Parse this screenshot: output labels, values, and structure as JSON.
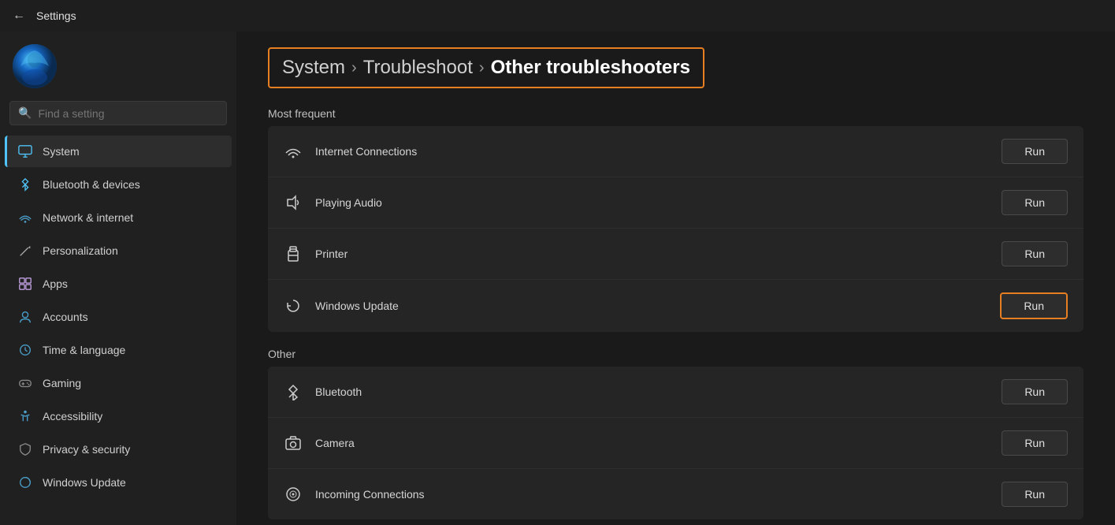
{
  "titlebar": {
    "title": "Settings",
    "back_label": "←"
  },
  "breadcrumb": {
    "part1": "System",
    "sep1": "›",
    "part2": "Troubleshoot",
    "sep2": "›",
    "current": "Other troubleshooters"
  },
  "search": {
    "placeholder": "Find a setting"
  },
  "sidebar": {
    "items": [
      {
        "id": "system",
        "label": "System",
        "icon": "🖥",
        "active": true
      },
      {
        "id": "bluetooth",
        "label": "Bluetooth & devices",
        "icon": "🔵"
      },
      {
        "id": "network",
        "label": "Network & internet",
        "icon": "🌐"
      },
      {
        "id": "personalization",
        "label": "Personalization",
        "icon": "✏️"
      },
      {
        "id": "apps",
        "label": "Apps",
        "icon": "📦"
      },
      {
        "id": "accounts",
        "label": "Accounts",
        "icon": "👤"
      },
      {
        "id": "time",
        "label": "Time & language",
        "icon": "🕐"
      },
      {
        "id": "gaming",
        "label": "Gaming",
        "icon": "🎮"
      },
      {
        "id": "accessibility",
        "label": "Accessibility",
        "icon": "♿"
      },
      {
        "id": "privacy",
        "label": "Privacy & security",
        "icon": "🛡"
      },
      {
        "id": "windows-update",
        "label": "Windows Update",
        "icon": "🔄"
      }
    ]
  },
  "most_frequent": {
    "label": "Most frequent",
    "items": [
      {
        "id": "internet",
        "icon": "wifi",
        "label": "Internet Connections",
        "btn": "Run",
        "highlighted": false
      },
      {
        "id": "audio",
        "icon": "speaker",
        "label": "Playing Audio",
        "btn": "Run",
        "highlighted": false
      },
      {
        "id": "printer",
        "icon": "printer",
        "label": "Printer",
        "btn": "Run",
        "highlighted": false
      },
      {
        "id": "windows-update",
        "icon": "refresh",
        "label": "Windows Update",
        "btn": "Run",
        "highlighted": true
      }
    ]
  },
  "other": {
    "label": "Other",
    "items": [
      {
        "id": "bluetooth",
        "icon": "bluetooth",
        "label": "Bluetooth",
        "btn": "Run",
        "highlighted": false
      },
      {
        "id": "camera",
        "icon": "camera",
        "label": "Camera",
        "btn": "Run",
        "highlighted": false
      },
      {
        "id": "incoming",
        "icon": "signal",
        "label": "Incoming Connections",
        "btn": "Run",
        "highlighted": false
      }
    ]
  }
}
